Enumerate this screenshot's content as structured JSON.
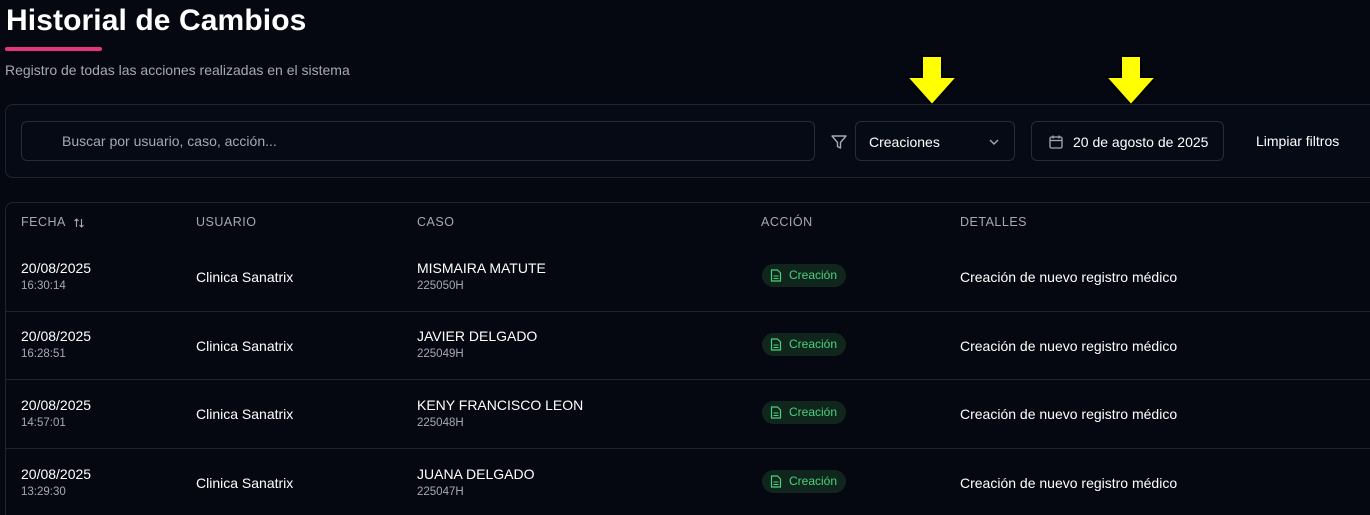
{
  "header": {
    "title": "Historial de Cambios",
    "subtitle": "Registro de todas las acciones realizadas en el sistema",
    "accent_color": "#e8347c"
  },
  "filters": {
    "search_placeholder": "Buscar por usuario, caso, acción...",
    "action_filter": "Creaciones",
    "date_filter": "20 de agosto de 2025",
    "clear_label": "Limpiar filtros",
    "annotation_arrow_color": "#ffff00"
  },
  "table": {
    "columns": [
      "FECHA",
      "USUARIO",
      "CASO",
      "ACCIÓN",
      "DETALLES"
    ],
    "badge_color": "#49d17e",
    "rows": [
      {
        "date": "20/08/2025",
        "time": "16:30:14",
        "user": "Clinica Sanatrix",
        "case_name": "MISMAIRA MATUTE",
        "case_id": "225050H",
        "action": "Creación",
        "details": "Creación de nuevo registro médico"
      },
      {
        "date": "20/08/2025",
        "time": "16:28:51",
        "user": "Clinica Sanatrix",
        "case_name": "JAVIER DELGADO",
        "case_id": "225049H",
        "action": "Creación",
        "details": "Creación de nuevo registro médico"
      },
      {
        "date": "20/08/2025",
        "time": "14:57:01",
        "user": "Clinica Sanatrix",
        "case_name": "KENY FRANCISCO LEON",
        "case_id": "225048H",
        "action": "Creación",
        "details": "Creación de nuevo registro médico"
      },
      {
        "date": "20/08/2025",
        "time": "13:29:30",
        "user": "Clinica Sanatrix",
        "case_name": "JUANA DELGADO",
        "case_id": "225047H",
        "action": "Creación",
        "details": "Creación de nuevo registro médico"
      }
    ]
  }
}
